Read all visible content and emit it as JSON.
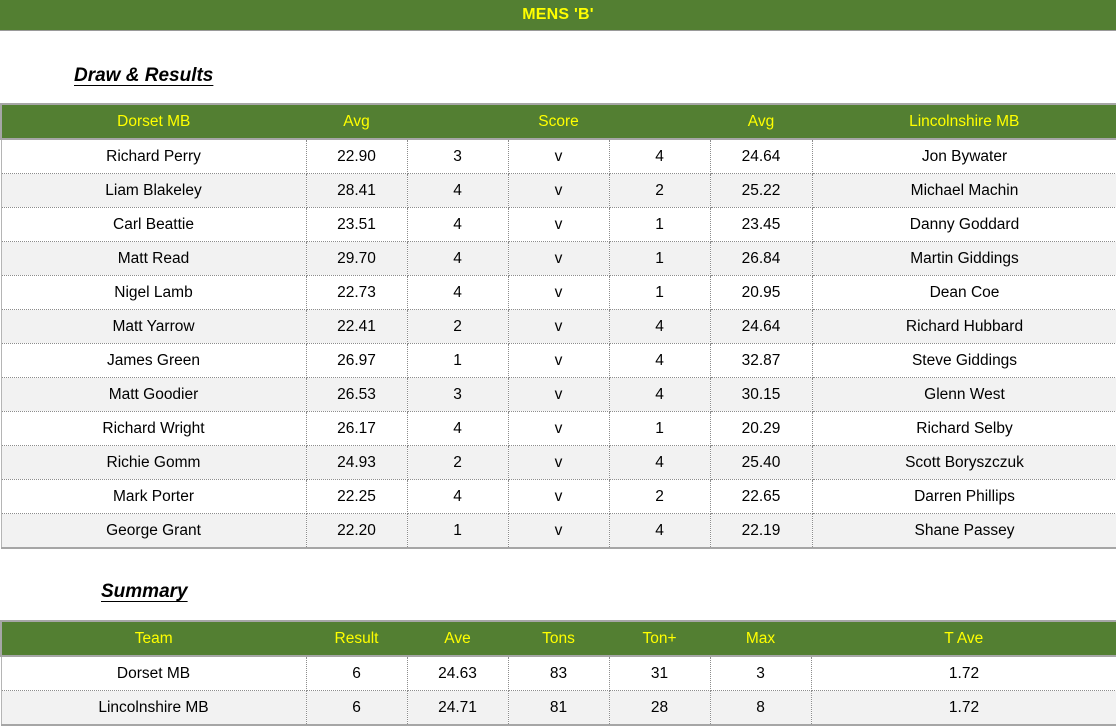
{
  "header": {
    "title": "MENS 'B'"
  },
  "sections": {
    "draw_results_heading": "Draw & Results",
    "summary_heading": "Summary"
  },
  "colors": {
    "header_green": "#537F32",
    "header_text_yellow": "#FFFF00",
    "row_stripe": "#F2F2F2",
    "grid_line": "#8c8c8c"
  },
  "results_table": {
    "columns": [
      "Dorset MB",
      "Avg",
      "Score",
      "Avg",
      "Lincolnshire MB"
    ],
    "headers": {
      "home_team": "Dorset MB",
      "home_avg": "Avg",
      "score": "Score",
      "away_avg": "Avg",
      "away_team": "Lincolnshire MB"
    },
    "rows": [
      {
        "home": "Richard Perry",
        "home_avg": "22.90",
        "home_score": "3",
        "v": "v",
        "away_score": "4",
        "away_avg": "24.64",
        "away": "Jon Bywater"
      },
      {
        "home": "Liam Blakeley",
        "home_avg": "28.41",
        "home_score": "4",
        "v": "v",
        "away_score": "2",
        "away_avg": "25.22",
        "away": "Michael Machin"
      },
      {
        "home": "Carl Beattie",
        "home_avg": "23.51",
        "home_score": "4",
        "v": "v",
        "away_score": "1",
        "away_avg": "23.45",
        "away": "Danny Goddard"
      },
      {
        "home": "Matt Read",
        "home_avg": "29.70",
        "home_score": "4",
        "v": "v",
        "away_score": "1",
        "away_avg": "26.84",
        "away": "Martin Giddings"
      },
      {
        "home": "Nigel Lamb",
        "home_avg": "22.73",
        "home_score": "4",
        "v": "v",
        "away_score": "1",
        "away_avg": "20.95",
        "away": "Dean Coe"
      },
      {
        "home": "Matt Yarrow",
        "home_avg": "22.41",
        "home_score": "2",
        "v": "v",
        "away_score": "4",
        "away_avg": "24.64",
        "away": "Richard Hubbard"
      },
      {
        "home": "James Green",
        "home_avg": "26.97",
        "home_score": "1",
        "v": "v",
        "away_score": "4",
        "away_avg": "32.87",
        "away": "Steve Giddings"
      },
      {
        "home": "Matt Goodier",
        "home_avg": "26.53",
        "home_score": "3",
        "v": "v",
        "away_score": "4",
        "away_avg": "30.15",
        "away": "Glenn West"
      },
      {
        "home": "Richard Wright",
        "home_avg": "26.17",
        "home_score": "4",
        "v": "v",
        "away_score": "1",
        "away_avg": "20.29",
        "away": "Richard Selby"
      },
      {
        "home": "Richie Gomm",
        "home_avg": "24.93",
        "home_score": "2",
        "v": "v",
        "away_score": "4",
        "away_avg": "25.40",
        "away": "Scott Boryszczuk"
      },
      {
        "home": "Mark Porter",
        "home_avg": "22.25",
        "home_score": "4",
        "v": "v",
        "away_score": "2",
        "away_avg": "22.65",
        "away": "Darren Phillips"
      },
      {
        "home": "George Grant",
        "home_avg": "22.20",
        "home_score": "1",
        "v": "v",
        "away_score": "4",
        "away_avg": "22.19",
        "away": "Shane Passey"
      }
    ]
  },
  "summary_table": {
    "headers": {
      "team": "Team",
      "result": "Result",
      "ave": "Ave",
      "tons": "Tons",
      "tonplus": "Ton+",
      "max": "Max",
      "tave": "T Ave"
    },
    "rows": [
      {
        "team": "Dorset MB",
        "result": "6",
        "ave": "24.63",
        "tons": "83",
        "tonplus": "31",
        "max": "3",
        "tave": "1.72"
      },
      {
        "team": "Lincolnshire MB",
        "result": "6",
        "ave": "24.71",
        "tons": "81",
        "tonplus": "28",
        "max": "8",
        "tave": "1.72"
      }
    ]
  }
}
